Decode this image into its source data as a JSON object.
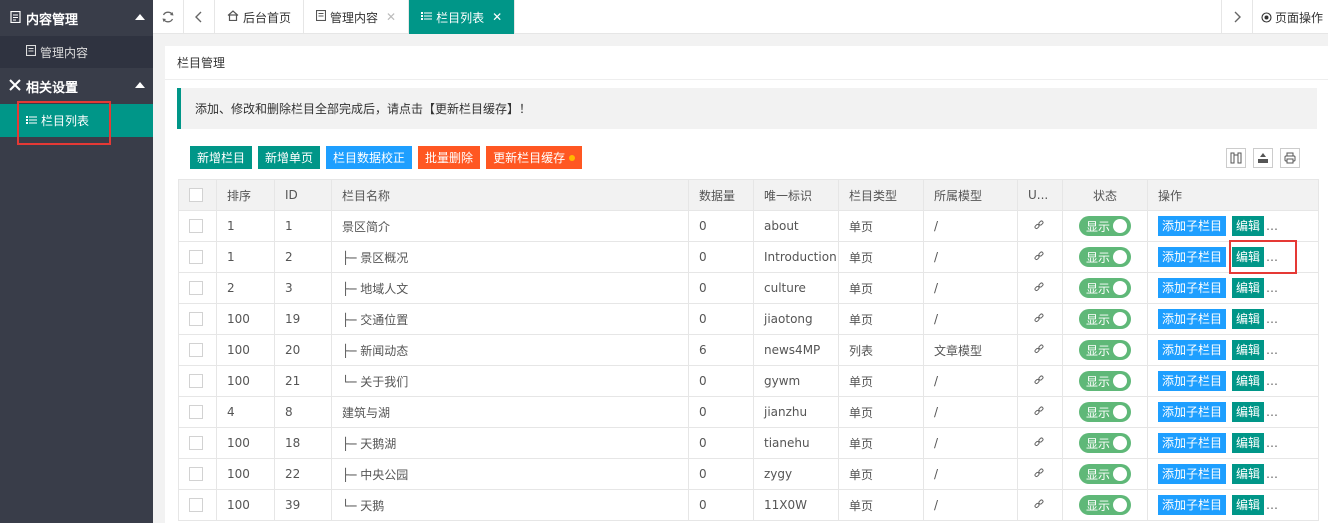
{
  "sidebar": {
    "groups": [
      {
        "label": "内容管理",
        "icon": "document-icon",
        "items": [
          {
            "label": "管理内容"
          }
        ]
      },
      {
        "label": "相关设置",
        "icon": "tools-icon",
        "items": [
          {
            "label": "栏目列表",
            "active": true
          }
        ]
      }
    ]
  },
  "tabs": [
    {
      "label": "后台首页",
      "icon": "home-icon"
    },
    {
      "label": "管理内容",
      "icon": "document-icon",
      "closable": true
    },
    {
      "label": "栏目列表",
      "icon": "list-icon",
      "closable": true,
      "active": true
    }
  ],
  "page_ops_label": "页面操作",
  "card_title": "栏目管理",
  "notice": "添加、修改和删除栏目全部完成后，请点击【更新栏目缓存】！",
  "toolbar": {
    "add_column": "新增栏目",
    "add_page": "新增单页",
    "verify": "栏目数据校正",
    "batch_delete": "批量删除",
    "update_cache": "更新栏目缓存"
  },
  "table": {
    "headers": [
      "排序",
      "ID",
      "栏目名称",
      "数据量",
      "唯一标识",
      "栏目类型",
      "所属模型",
      "U...",
      "状态",
      "操作"
    ],
    "status_label": "显示",
    "add_child_label": "添加子栏目",
    "edit_label": "编辑",
    "more_label": "…",
    "rows": [
      {
        "sort": "1",
        "id": "1",
        "name": "景区简介",
        "count": "0",
        "key": "about",
        "type": "单页",
        "model": "/"
      },
      {
        "sort": "1",
        "id": "2",
        "name": "├─ 景区概况",
        "count": "0",
        "key": "Introduction",
        "type": "单页",
        "model": "/"
      },
      {
        "sort": "2",
        "id": "3",
        "name": "├─ 地域人文",
        "count": "0",
        "key": "culture",
        "type": "单页",
        "model": "/"
      },
      {
        "sort": "100",
        "id": "19",
        "name": "├─ 交通位置",
        "count": "0",
        "key": "jiaotong",
        "type": "单页",
        "model": "/"
      },
      {
        "sort": "100",
        "id": "20",
        "name": "├─ 新闻动态",
        "count": "6",
        "key": "news4MP",
        "type": "列表",
        "model": "文章模型"
      },
      {
        "sort": "100",
        "id": "21",
        "name": "└─ 关于我们",
        "count": "0",
        "key": "gywm",
        "type": "单页",
        "model": "/"
      },
      {
        "sort": "4",
        "id": "8",
        "name": "建筑与湖",
        "count": "0",
        "key": "jianzhu",
        "type": "单页",
        "model": "/"
      },
      {
        "sort": "100",
        "id": "18",
        "name": "├─ 天鹅湖",
        "count": "0",
        "key": "tianehu",
        "type": "单页",
        "model": "/"
      },
      {
        "sort": "100",
        "id": "22",
        "name": "├─ 中央公园",
        "count": "0",
        "key": "zygy",
        "type": "单页",
        "model": "/"
      },
      {
        "sort": "100",
        "id": "39",
        "name": "└─ 天鹅",
        "count": "0",
        "key": "11X0W",
        "type": "单页",
        "model": "/"
      }
    ]
  },
  "colors": {
    "sidebar_bg": "#393d49",
    "accent": "#009688",
    "blue": "#1e9fff",
    "orange": "#ff5722",
    "toggle": "#5fb878",
    "highlight": "#e53935"
  }
}
